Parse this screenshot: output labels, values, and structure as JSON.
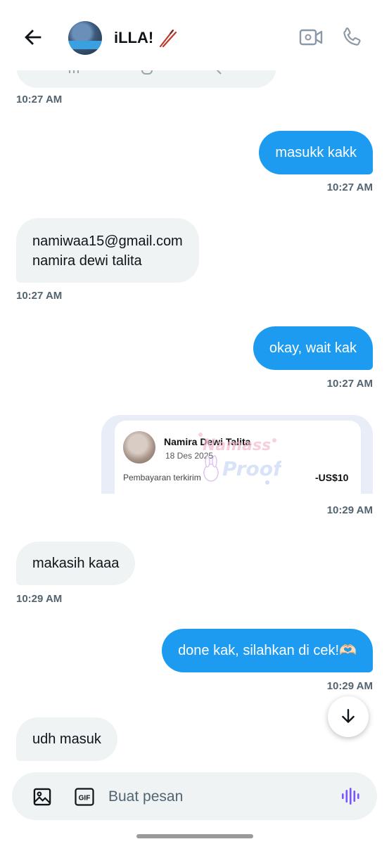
{
  "header": {
    "contact_name": "iLLA!",
    "icons": [
      "back-arrow-icon",
      "avatar",
      "chopsticks-emoji-icon",
      "video-call-icon",
      "phone-call-icon"
    ]
  },
  "messages": [
    {
      "id": "m0",
      "direction": "in",
      "text": "",
      "time": "10:27 AM"
    },
    {
      "id": "m1",
      "direction": "out",
      "text": "masukk kakk",
      "time": "10:27 AM"
    },
    {
      "id": "m2",
      "direction": "in",
      "lines": [
        "namiwaa15@gmail.com",
        "namira dewi talita"
      ],
      "time": "10:27 AM"
    },
    {
      "id": "m3",
      "direction": "out",
      "text": "okay, wait kak",
      "time": "10:27 AM"
    },
    {
      "id": "m4",
      "direction": "out",
      "type": "image",
      "time": "10:29 AM"
    },
    {
      "id": "m5",
      "direction": "in",
      "text": "makasih kaaa",
      "time": "10:29 AM"
    },
    {
      "id": "m6",
      "direction": "out",
      "text": "done kak, silahkan di cek!🫶🏻",
      "time": "10:29 AM"
    },
    {
      "id": "m7",
      "direction": "in",
      "text": "udh masuk"
    }
  ],
  "payment_card": {
    "name": "Namira Dewi Talita",
    "date": "18 Des 2025",
    "status": "Pembayaran terkirim",
    "amount": "-US$10",
    "watermark": "Namass Proof"
  },
  "composer": {
    "placeholder": "Buat pesan",
    "gif_label": "GIF"
  },
  "colors": {
    "outgoing_bubble": "#1d9bf0",
    "incoming_bubble": "#eff3f4",
    "timestamp": "#536471",
    "voice_accent": "#7856ff"
  }
}
